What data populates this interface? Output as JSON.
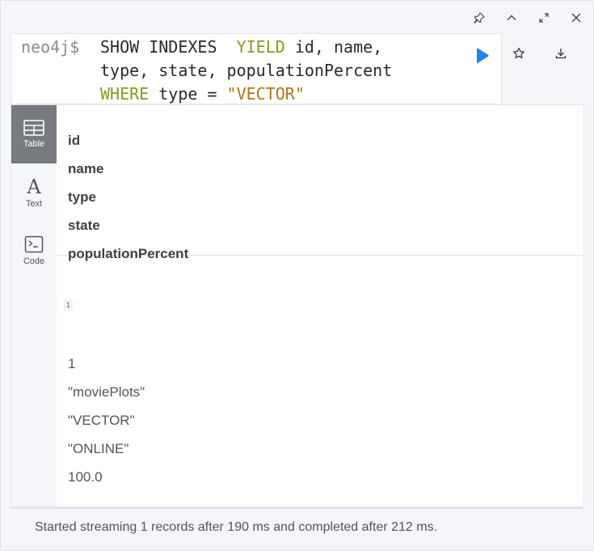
{
  "window": {
    "controls": [
      "pin-icon",
      "chevron-up-icon",
      "expand-icon",
      "close-icon"
    ]
  },
  "editor": {
    "prompt": "neo4j$",
    "lines": [
      {
        "parts": [
          {
            "t": "SHOW INDEXES  ",
            "c": "plain"
          },
          {
            "t": "YIELD",
            "c": "kw"
          },
          {
            "t": " id, name,",
            "c": "plain"
          }
        ]
      },
      {
        "parts": [
          {
            "t": "type, state, populationPercent",
            "c": "plain"
          }
        ]
      },
      {
        "parts": [
          {
            "t": "WHERE",
            "c": "kw"
          },
          {
            "t": " type = ",
            "c": "plain"
          },
          {
            "t": "\"VECTOR\"",
            "c": "str"
          }
        ]
      }
    ],
    "run_icon": "play-icon",
    "favorite_icon": "star-icon",
    "download_icon": "download-icon",
    "accent": "#1e88e5"
  },
  "tabs": [
    {
      "label": "Table",
      "icon": "table-icon",
      "active": true
    },
    {
      "label": "Text",
      "icon": "text-icon",
      "active": false
    },
    {
      "label": "Code",
      "icon": "code-icon",
      "active": false
    }
  ],
  "table": {
    "headers": [
      "id",
      "name",
      "type",
      "state",
      "populationPercent"
    ],
    "row_number": "1",
    "values": [
      "1",
      "\"moviePlots\"",
      "\"VECTOR\"",
      "\"ONLINE\"",
      "100.0"
    ]
  },
  "status": "Started streaming 1 records after 190 ms and completed after 212 ms."
}
